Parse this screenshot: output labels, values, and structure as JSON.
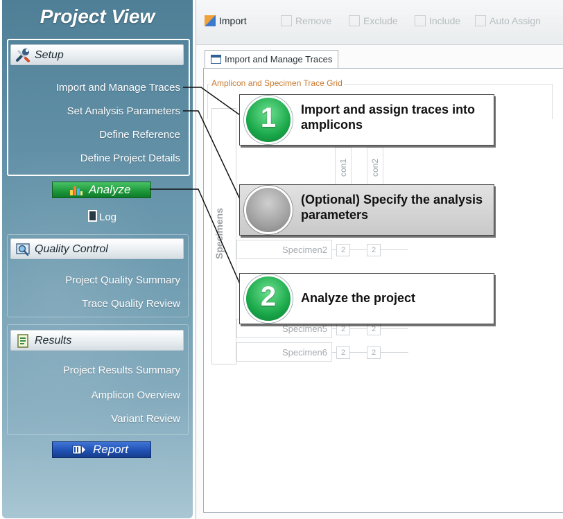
{
  "sidebar": {
    "title": "Project View",
    "setup": {
      "header": "Setup",
      "links": [
        "Import and Manage Traces",
        "Set Analysis Parameters",
        "Define Reference",
        "Define Project Details"
      ]
    },
    "analyze_label": "Analyze",
    "log_label": "Log",
    "quality_control": {
      "header": "Quality Control",
      "links": [
        "Project Quality Summary",
        "Trace Quality Review"
      ]
    },
    "results": {
      "header": "Results",
      "links": [
        "Project Results Summary",
        "Amplicon Overview",
        "Variant Review"
      ]
    },
    "report_label": "Report"
  },
  "toolbar": {
    "items": [
      {
        "label": "Import",
        "icon": "import-icon",
        "enabled": true
      },
      {
        "label": "Remove",
        "icon": "remove-icon",
        "enabled": false
      },
      {
        "label": "Exclude",
        "icon": "exclude-icon",
        "enabled": false
      },
      {
        "label": "Include",
        "icon": "include-icon",
        "enabled": false
      },
      {
        "label": "Auto Assign",
        "icon": "auto-assign-icon",
        "enabled": false
      }
    ]
  },
  "main": {
    "tab_label": "Import and Manage Traces",
    "grid_title": "Amplicon and Specimen Trace Grid",
    "side_header": "Specimens",
    "columns": [
      "con1",
      "con2"
    ],
    "rows": [
      {
        "label": "Specimen2",
        "cells": [
          "2",
          "2"
        ]
      },
      {
        "label": "Specimen5",
        "cells": [
          "2",
          "2"
        ]
      },
      {
        "label": "Specimen6",
        "cells": [
          "2",
          "2"
        ]
      }
    ]
  },
  "callouts": [
    {
      "badge": "1",
      "text": "Import and assign traces into amplicons",
      "style": "green"
    },
    {
      "badge": "",
      "text": "(Optional) Specify the analysis parameters",
      "style": "grey"
    },
    {
      "badge": "2",
      "text": "Analyze the project",
      "style": "green"
    }
  ],
  "colors": {
    "sidebar_top": "#4f7f96",
    "analyze_button": "#1f9a3c",
    "report_button": "#2152b3",
    "badge_green": "#1aa84a",
    "grid_title": "#c97a32"
  }
}
